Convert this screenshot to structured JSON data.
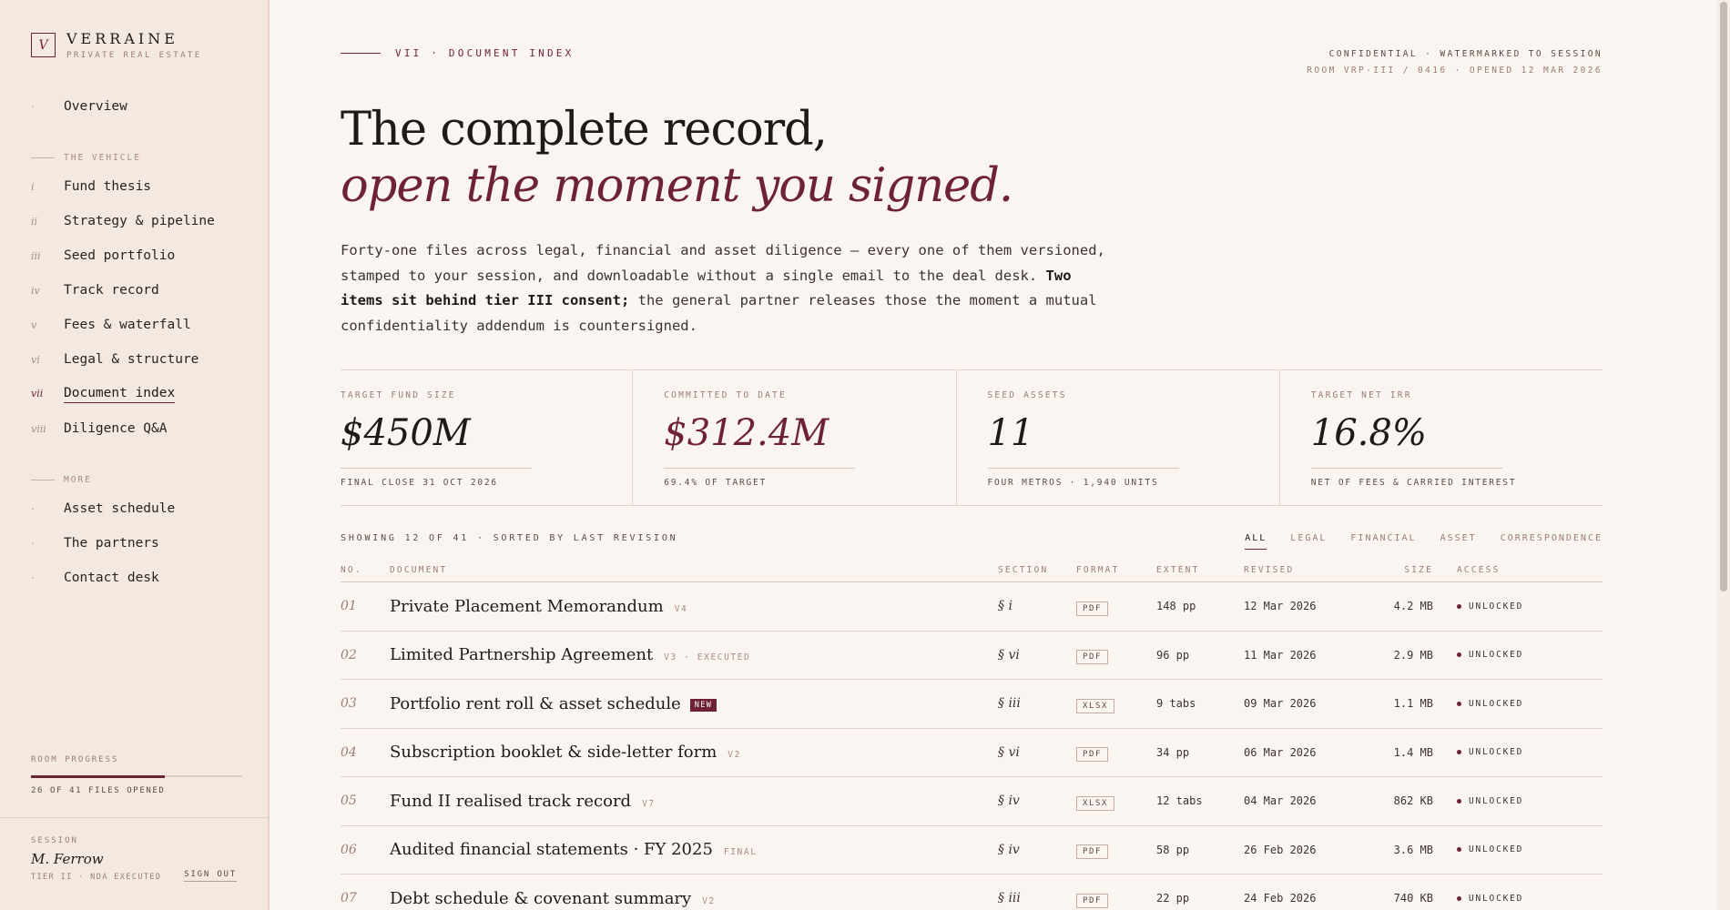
{
  "brand": {
    "mark": "V",
    "name": "VERRAINE",
    "tagline": "PRIVATE REAL ESTATE"
  },
  "nav": {
    "overview": {
      "bullet": "·",
      "label": "Overview"
    },
    "section_vehicle": "THE VEHICLE",
    "vehicle": [
      {
        "num": "i",
        "label": "Fund thesis"
      },
      {
        "num": "ii",
        "label": "Strategy & pipeline"
      },
      {
        "num": "iii",
        "label": "Seed portfolio"
      },
      {
        "num": "iv",
        "label": "Track record"
      },
      {
        "num": "v",
        "label": "Fees & waterfall"
      },
      {
        "num": "vi",
        "label": "Legal & structure"
      },
      {
        "num": "vii",
        "label": "Document index"
      },
      {
        "num": "viii",
        "label": "Diligence Q&A"
      }
    ],
    "active_index": 6,
    "section_more": "MORE",
    "more": [
      {
        "bullet": "·",
        "label": "Asset schedule"
      },
      {
        "bullet": "·",
        "label": "The partners"
      },
      {
        "bullet": "·",
        "label": "Contact desk"
      }
    ]
  },
  "progress": {
    "label": "ROOM PROGRESS",
    "opened": 26,
    "total": 41,
    "fraction": 0.634,
    "text": "26 OF 41 FILES OPENED"
  },
  "session": {
    "label": "SESSION",
    "name": "M. Ferrow",
    "tier": "TIER II · NDA EXECUTED",
    "signout": "SIGN OUT"
  },
  "header": {
    "eyebrow": "VII · DOCUMENT INDEX",
    "confidential": "CONFIDENTIAL · WATERMARKED TO SESSION",
    "room": "ROOM VRP-III / 0416 · OPENED 12 MAR 2026",
    "headline_1": "The complete record,",
    "headline_2": "open the moment you signed.",
    "lede_1": "Forty-one files across legal, financial and asset diligence — every one of them versioned, stamped to your session, and downloadable without a single email to the deal desk. ",
    "lede_bold": "Two items sit behind tier III consent;",
    "lede_2": " the general partner releases those the moment a mutual confidentiality addendum is countersigned."
  },
  "stats": [
    {
      "label": "TARGET FUND SIZE",
      "value": "$450M",
      "foot": "FINAL CLOSE 31 OCT 2026",
      "accent": false
    },
    {
      "label": "COMMITTED TO DATE",
      "value": "$312.4M",
      "foot": "69.4% OF TARGET",
      "accent": true
    },
    {
      "label": "SEED ASSETS",
      "value": "11",
      "foot": "FOUR METROS · 1,940 UNITS",
      "accent": false
    },
    {
      "label": "TARGET NET IRR",
      "value": "16.8%",
      "foot": "NET OF FEES & CARRIED INTEREST",
      "accent": false
    }
  ],
  "toolbar": {
    "showing": "SHOWING 12 OF 41 · SORTED BY LAST REVISION",
    "filters": [
      "ALL",
      "LEGAL",
      "FINANCIAL",
      "ASSET",
      "CORRESPONDENCE"
    ],
    "active_filter": 0
  },
  "table": {
    "headers": {
      "no": "NO.",
      "document": "DOCUMENT",
      "section": "SECTION",
      "format": "FORMAT",
      "extent": "EXTENT",
      "revised": "REVISED",
      "size": "SIZE",
      "access": "ACCESS"
    },
    "rows": [
      {
        "no": "01",
        "title": "Private Placement Memorandum",
        "tag": "V4",
        "new": false,
        "section": "§ i",
        "format": "PDF",
        "extent": "148 pp",
        "revised": "12 Mar 2026",
        "size": "4.2 MB",
        "access": "UNLOCKED"
      },
      {
        "no": "02",
        "title": "Limited Partnership Agreement",
        "tag": "V3 · EXECUTED",
        "new": false,
        "section": "§ vi",
        "format": "PDF",
        "extent": "96 pp",
        "revised": "11 Mar 2026",
        "size": "2.9 MB",
        "access": "UNLOCKED"
      },
      {
        "no": "03",
        "title": "Portfolio rent roll & asset schedule",
        "tag": "NEW",
        "new": true,
        "section": "§ iii",
        "format": "XLSX",
        "extent": "9 tabs",
        "revised": "09 Mar 2026",
        "size": "1.1 MB",
        "access": "UNLOCKED"
      },
      {
        "no": "04",
        "title": "Subscription booklet & side-letter form",
        "tag": "V2",
        "new": false,
        "section": "§ vi",
        "format": "PDF",
        "extent": "34 pp",
        "revised": "06 Mar 2026",
        "size": "1.4 MB",
        "access": "UNLOCKED"
      },
      {
        "no": "05",
        "title": "Fund II realised track record",
        "tag": "V7",
        "new": false,
        "section": "§ iv",
        "format": "XLSX",
        "extent": "12 tabs",
        "revised": "04 Mar 2026",
        "size": "862 KB",
        "access": "UNLOCKED"
      },
      {
        "no": "06",
        "title": "Audited financial statements · FY 2025",
        "tag": "FINAL",
        "new": false,
        "section": "§ iv",
        "format": "PDF",
        "extent": "58 pp",
        "revised": "26 Feb 2026",
        "size": "3.6 MB",
        "access": "UNLOCKED"
      },
      {
        "no": "07",
        "title": "Debt schedule & covenant summary",
        "tag": "V2",
        "new": false,
        "section": "§ iii",
        "format": "PDF",
        "extent": "22 pp",
        "revised": "24 Feb 2026",
        "size": "740 KB",
        "access": "UNLOCKED"
      }
    ]
  },
  "colors": {
    "accent": "#6e2237",
    "page_bg": "#faf5f0",
    "sidebar_bg": "#f4e9e0"
  }
}
